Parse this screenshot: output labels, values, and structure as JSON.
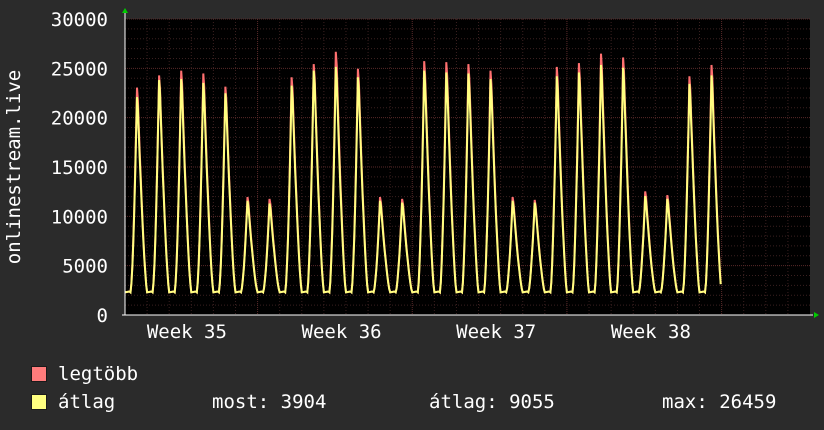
{
  "chart_data": {
    "type": "line",
    "ylabel": "onlinestream.live",
    "ylim": [
      0,
      30000
    ],
    "yticks": [
      0,
      5000,
      10000,
      15000,
      20000,
      25000,
      30000
    ],
    "x_tick_labels": [
      "Week 35",
      "Week 36",
      "Week 37",
      "Week 38"
    ],
    "grid": true,
    "days": 31,
    "series": [
      {
        "name": "legtöbb",
        "color": "#ff7070",
        "daily_peaks": [
          24000,
          25300,
          25800,
          25500,
          24100,
          12400,
          12200,
          25100,
          26500,
          27800,
          26000,
          12400,
          12200,
          26800,
          26700,
          26500,
          25800,
          12400,
          12100,
          26200,
          26600,
          27600,
          27200,
          13000,
          12600,
          25200,
          26400
        ]
      },
      {
        "name": "átlag",
        "color": "#ffff80",
        "daily_peaks": [
          23000,
          24800,
          24900,
          24500,
          23400,
          12000,
          11700,
          24200,
          25800,
          26200,
          25100,
          12000,
          11800,
          25800,
          25600,
          25500,
          24900,
          12000,
          11800,
          25200,
          25600,
          26400,
          26100,
          12500,
          12200,
          24400,
          25300
        ]
      }
    ]
  },
  "legend": {
    "max_label": "legtöbb",
    "avg_label": "átlag",
    "max_color": "#ff7c7c",
    "avg_color": "#ffff80",
    "stats": {
      "now": "most: 3904",
      "avg": "átlag: 9055",
      "max": "max: 26459"
    }
  }
}
